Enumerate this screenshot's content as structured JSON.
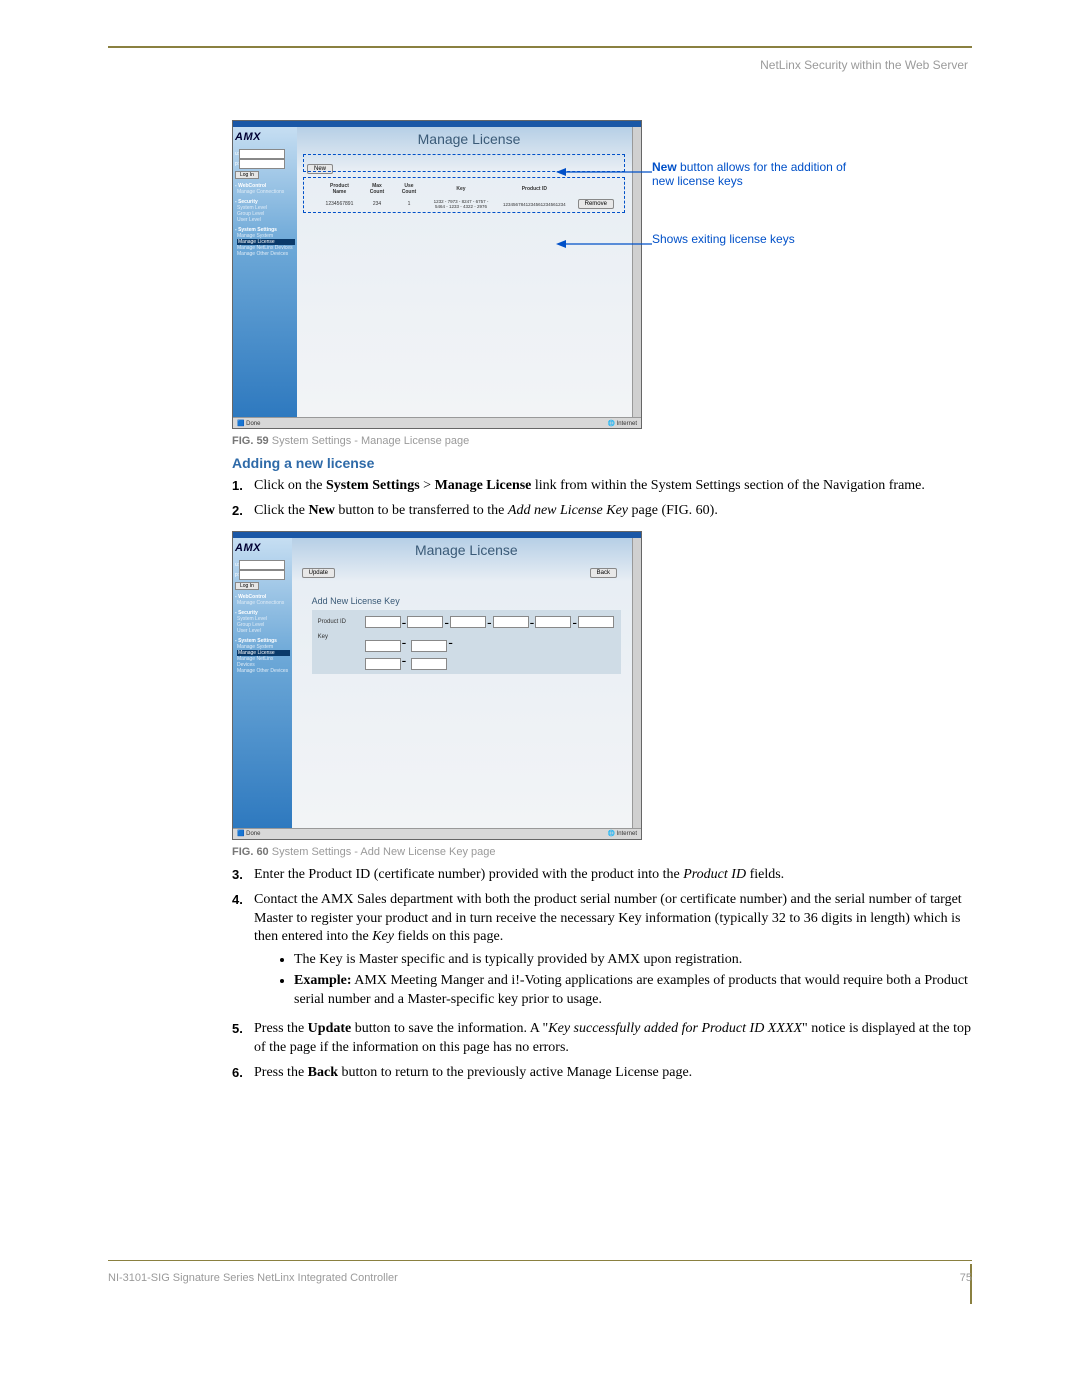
{
  "header": "NetLinx Security within the Web Server",
  "footer_left": "NI-3101-SIG Signature Series NetLinx Integrated Controller",
  "footer_right": "75",
  "fig59": {
    "logo": "AMX",
    "title": "Manage License",
    "login_btn": "Log In",
    "new_btn": "New",
    "remove_btn": "Remove",
    "status_left": "Done",
    "status_right": "Internet",
    "nav": {
      "webcontrol": "WebControl",
      "wc_item": "Manage Connections",
      "security": "Security",
      "sec1": "System Level",
      "sec2": "Group Level",
      "sec3": "User Level",
      "system_settings": "System Settings",
      "ss1": "Manage System",
      "ss2": "Manage License",
      "ss3": "Manage NetLinx Devices",
      "ss4": "Manage Other Devices"
    },
    "table": {
      "h1": "Product Name",
      "h2": "Max\nCount",
      "h3": "Use\nCount",
      "h4": "Key",
      "h5": "Product ID",
      "r": {
        "name": "1234567891",
        "max": "234",
        "use": "1",
        "key": "1232 - 7973 - 8247 - 6757 - 5464 - 1233 - 4322 - 2976",
        "pid": "1234567841234561234561234"
      }
    },
    "callout1_a": "New",
    "callout1_b": " button allows for the addition of new license keys",
    "callout2": "Shows exiting license keys",
    "caption_b": "FIG. 59",
    "caption_t": "  System Settings - Manage License page"
  },
  "section_title": "Adding a new license",
  "step1_a": "Click on the ",
  "step1_b": "System Settings",
  "step1_c": " > ",
  "step1_d": "Manage License",
  "step1_e": " link from within the System Settings section of the Navigation frame.",
  "step2_a": "Click the ",
  "step2_b": "New",
  "step2_c": " button to be transferred to the ",
  "step2_d": "Add new License Key",
  "step2_e": " page (FIG. 60).",
  "fig60": {
    "title": "Manage License",
    "update_btn": "Update",
    "back_btn": "Back",
    "form_title": "Add New License Key",
    "lbl_pid": "Product ID",
    "lbl_key": "Key",
    "caption_b": "FIG. 60",
    "caption_t": "  System Settings - Add New License Key page"
  },
  "step3_a": "Enter the Product ID (certificate number) provided with the product into the ",
  "step3_b": "Product ID",
  "step3_c": " fields.",
  "step4_a": "Contact the AMX Sales department with both the product serial number (or certificate number) and the serial number of target Master to register your product and in turn receive the necessary Key information (typically 32 to 36 digits in length) which is then entered into the ",
  "step4_b": "Key",
  "step4_c": " fields on this page.",
  "step4_bullet1": "The Key is Master specific and is typically provided by AMX upon registration.",
  "step4_bullet2_a": "Example:",
  "step4_bullet2_b": " AMX Meeting Manger and i!-Voting applications are examples of products that would require both a Product serial number and a Master-specific key prior to usage.",
  "step5_a": "Press the ",
  "step5_b": "Update",
  "step5_c": " button to save the information. A \"",
  "step5_d": "Key successfully added for Product ID XXXX",
  "step5_e": "\" notice is displayed at the top of the page if the information on this page has no errors.",
  "step6_a": "Press the ",
  "step6_b": "Back",
  "step6_c": " button to return to the previously active Manage License page."
}
